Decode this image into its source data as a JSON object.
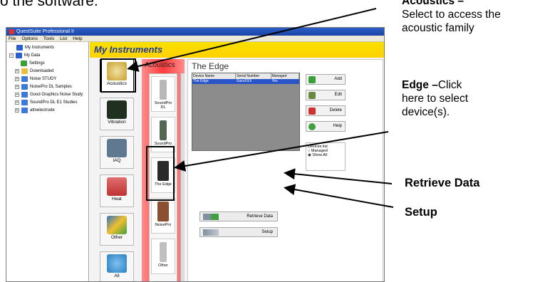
{
  "intro_text": "o the software.",
  "callouts": {
    "acoustics": {
      "title": "Acoustics –",
      "text_line1": "Select to access the",
      "text_line2": "acoustic family"
    },
    "edge": {
      "title": "Edge –",
      "title_rest": "Click",
      "text_line1": "here to select",
      "text_line2": "device(s)."
    },
    "retrieve": "Retrieve Data",
    "setup": "Setup"
  },
  "window": {
    "title": "QuestSuite Professional II",
    "menu": [
      "File",
      "Options",
      "Tools",
      "List",
      "Help"
    ],
    "header_title": "My Instruments"
  },
  "tree": {
    "items": [
      {
        "label": "My Instruments",
        "color": "#2a5fd0"
      },
      {
        "label": "My Data",
        "color": "#2a5fd0"
      },
      {
        "label": "Settings",
        "color": "#3aa03a"
      },
      {
        "label": "Downloaded",
        "color": "#e8c040"
      },
      {
        "label": "Noise STUDY",
        "color": "#3a7ad8"
      },
      {
        "label": "NoisePro DL Samples",
        "color": "#3a7ad8"
      },
      {
        "label": "Good Graphics Noise Study",
        "color": "#3a7ad8"
      },
      {
        "label": "SoundPro DL E1 Studies",
        "color": "#3a7ad8"
      },
      {
        "label": "attnelectrode",
        "color": "#3a7ad8"
      }
    ]
  },
  "categories": [
    {
      "label": "Acoustics",
      "icon": "acoustics-icon",
      "color": "#c8a030"
    },
    {
      "label": "Vibration",
      "icon": "vibration-icon",
      "color": "#203020"
    },
    {
      "label": "IAQ",
      "icon": "iaq-icon",
      "color": "#607890"
    },
    {
      "label": "Heat",
      "icon": "heat-icon",
      "color": "#c03030"
    },
    {
      "label": "Other",
      "icon": "other-icon",
      "color": "#3070c0"
    },
    {
      "label": "All",
      "icon": "all-icon",
      "color": "#2a80c0"
    }
  ],
  "device_panel": {
    "title": "Acoustics",
    "devices": [
      {
        "label": "SoundPro DL",
        "color": "#b8b8b8"
      },
      {
        "label": "SoundPro",
        "color": "#556655"
      },
      {
        "label": "The Edge",
        "color": "#2a2a2a"
      },
      {
        "label": "NoisePro",
        "color": "#8a5030"
      },
      {
        "label": "Other",
        "color": "#c0c0c0"
      }
    ]
  },
  "main": {
    "title": "The Edge",
    "columns": [
      "Device Name",
      "Serial Number",
      "Managed"
    ],
    "rows": [
      [
        "The Edge",
        "EaxxXXX",
        "Yes"
      ]
    ],
    "buttons": {
      "add": "Add",
      "edit": "Edit",
      "delete": "Delete",
      "help": "Help"
    },
    "devices_list": {
      "label": "Devices list",
      "option1": "Managed",
      "option2": "Show All"
    },
    "retrieve_button": "Retrieve Data",
    "setup_button": "Setup"
  },
  "colors": {
    "header_yellow": "#ffd200",
    "panel_red": "#ff3a3a",
    "selection_blue": "#2a55c8"
  }
}
